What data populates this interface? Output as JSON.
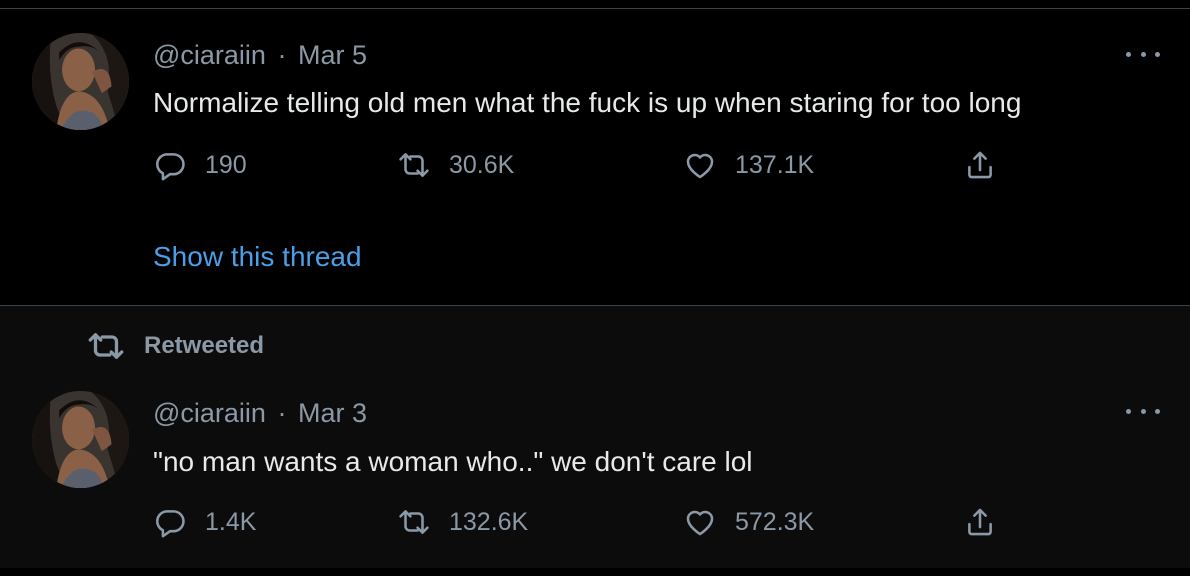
{
  "tweets": [
    {
      "handle": "@ciaraiin",
      "separator": "·",
      "date": "Mar 5",
      "text": "Normalize telling old men what the fuck is up when staring for too long",
      "replies": "190",
      "retweets": "30.6K",
      "likes": "137.1K",
      "show_thread": "Show this thread"
    },
    {
      "retweet_label": "Retweeted",
      "handle": "@ciaraiin",
      "separator": "·",
      "date": "Mar 3",
      "text": "\"no man wants a woman who..\" we don't care lol",
      "replies": "1.4K",
      "retweets": "132.6K",
      "likes": "572.3K"
    }
  ],
  "colors": {
    "background": "#000000",
    "text_primary": "#e7e9ea",
    "text_secondary": "#8b98a5",
    "link": "#4a9fe8",
    "divider": "#38444d"
  },
  "icons": [
    "more-icon",
    "reply-icon",
    "retweet-icon",
    "like-icon",
    "share-icon"
  ]
}
